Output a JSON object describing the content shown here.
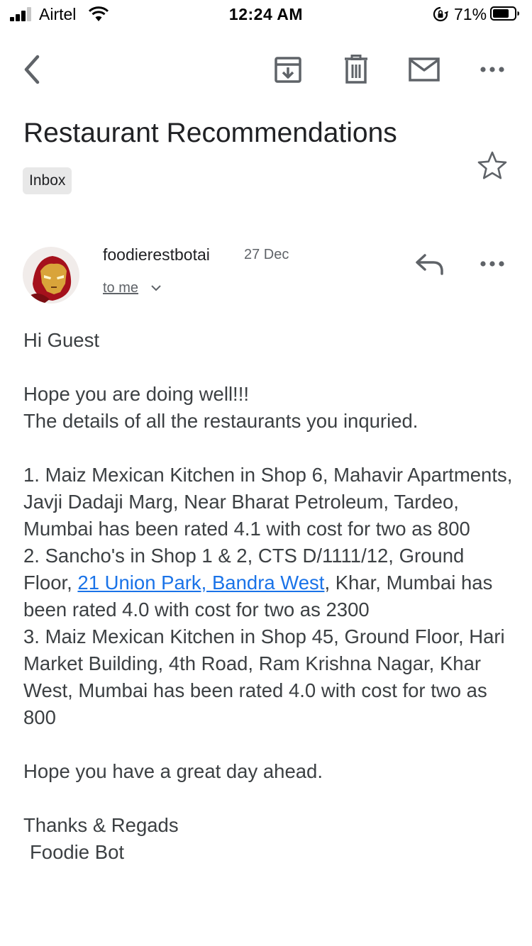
{
  "status_bar": {
    "carrier": "Airtel",
    "time": "12:24 AM",
    "battery": "71%"
  },
  "toolbar": {
    "icons": [
      "back-arrow-icon",
      "archive-icon",
      "delete-icon",
      "mail-icon",
      "more-icon"
    ]
  },
  "email": {
    "subject": "Restaurant Recommendations",
    "label": "Inbox",
    "sender": "foodierestbotai",
    "date": "27 Dec",
    "recipient": "to me",
    "body": {
      "greeting": "Hi Guest",
      "line1": "Hope you are doing well!!!",
      "line2": "The details of all the restaurants you inquried.",
      "item1": "1. Maiz Mexican Kitchen in Shop 6, Mahavir Apartments, Javji Dadaji Marg, Near Bharat Petroleum, Tardeo, Mumbai has been rated 4.1 with cost for two as 800",
      "item2_before": "2. Sancho's in Shop 1 & 2, CTS D/1111/12, Ground Floor, ",
      "item2_link": "21 Union Park, Bandra West",
      "item2_after": ", Khar, Mumbai has been rated 4.0 with cost for two as 2300",
      "item3": "3. Maiz Mexican Kitchen in Shop 45, Ground Floor, Hari Market Building, 4th Road, Ram Krishna Nagar, Khar West, Mumbai has been rated 4.0 with cost for two as 800",
      "closing": "Hope you have a great day ahead.",
      "signoff": "Thanks & Regads",
      "signature": "Foodie Bot"
    }
  },
  "colors": {
    "link": "#1a73e8",
    "text": "#3c4043",
    "icon": "#5f6368",
    "chip_bg": "#e8e8e8"
  }
}
